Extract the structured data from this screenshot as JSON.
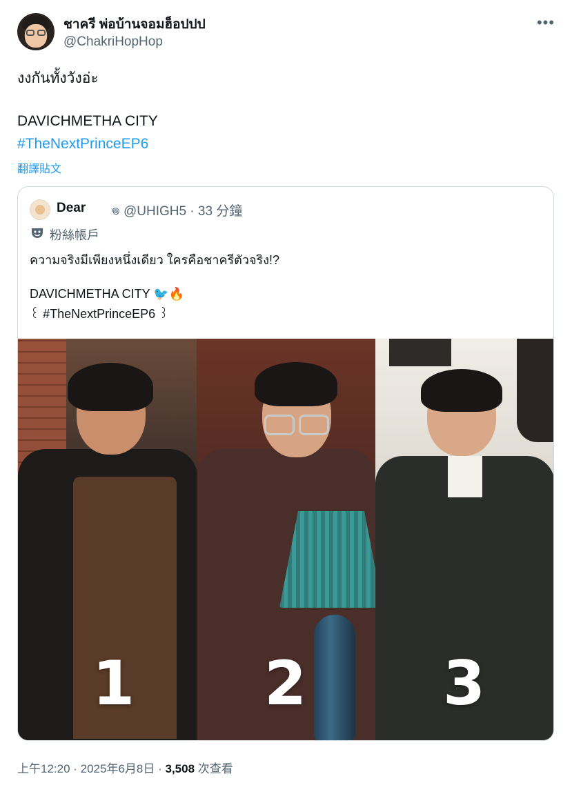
{
  "author": {
    "display_name": "ชาครี พ่อบ้านจอมฮ็อปปป",
    "handle": "@ChakriHopHop"
  },
  "more_icon": "more-horizontal-icon",
  "tweet": {
    "line1": "งงกันทั้งวังอ่ะ",
    "line2": "DAVICHMETHA CITY",
    "hashtag": "#TheNextPrinceEP6",
    "translate_label": "翻譯貼文"
  },
  "quote": {
    "display_name": "Dear",
    "handle_time": "𖦹 @UHIGH5 · 33 分鐘",
    "account_label": "粉絲帳戶",
    "label_icon": "theater-masks-icon",
    "line1": "ความจริงมีเพียงหนึ่งเดียว ใครคือชาครีตัวจริง!?",
    "line2": "DAVICHMETHA CITY 🐦🔥",
    "line3": "꒰ #TheNextPrinceEP6 ꒱",
    "media_numbers": [
      "1",
      "2",
      "3"
    ]
  },
  "footer": {
    "time_date": "上午12:20 · 2025年6月8日 · ",
    "views_count": "3,508",
    "views_label": " 次查看"
  },
  "colors": {
    "link": "#1d9bf0",
    "secondary_text": "#536471",
    "border": "#cfd9de"
  }
}
